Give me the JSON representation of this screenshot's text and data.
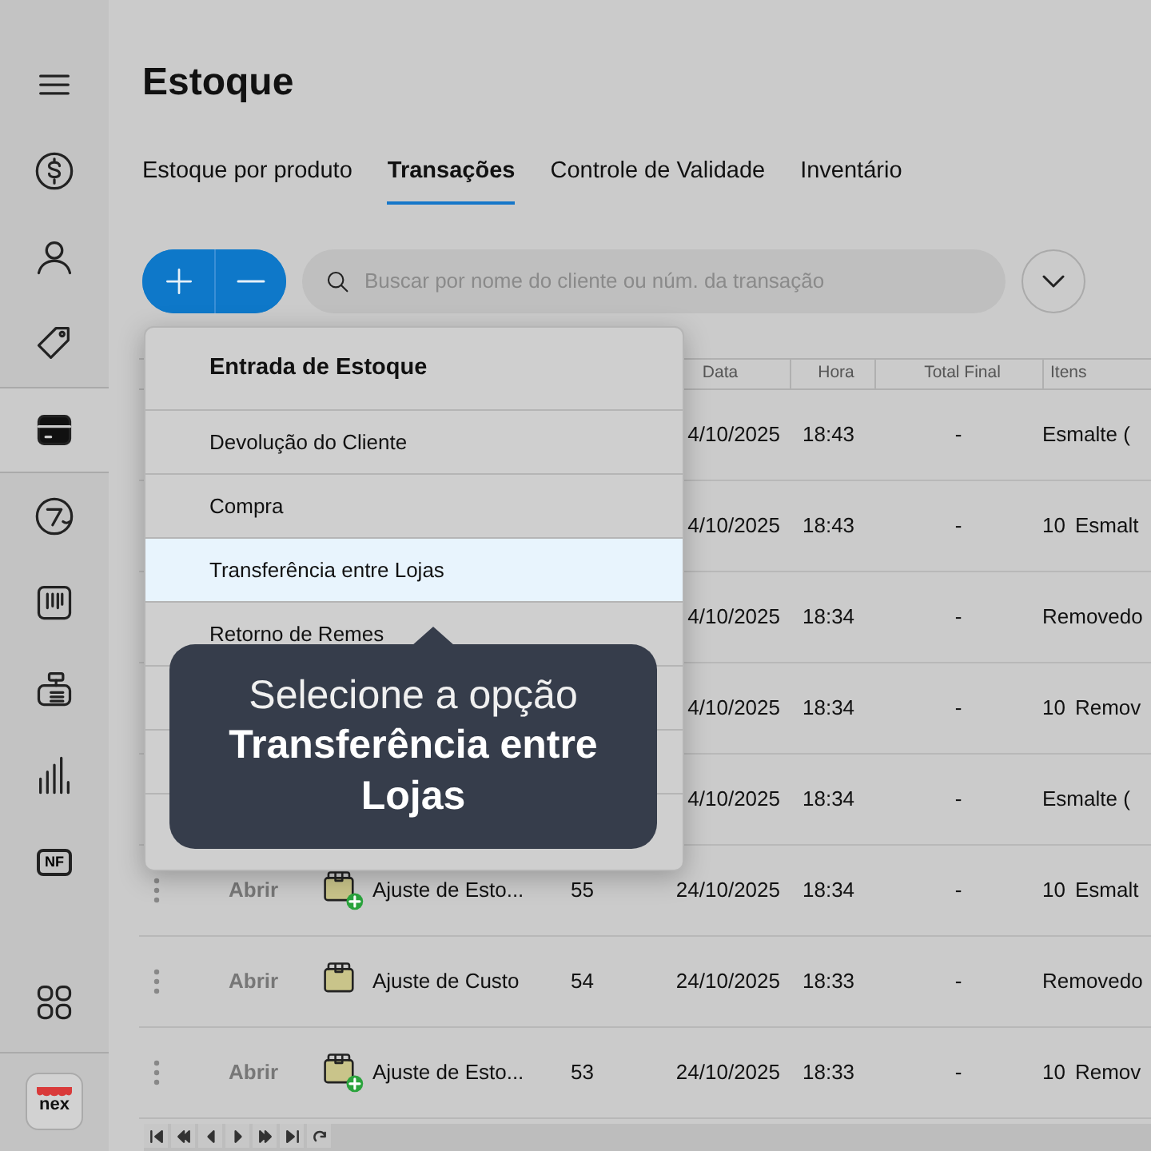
{
  "sidebar": {
    "menu_button": {
      "kind": "menu"
    },
    "items": [
      {
        "kind": "money",
        "selected": false
      },
      {
        "kind": "user",
        "selected": false
      },
      {
        "kind": "tag",
        "selected": false
      },
      {
        "kind": "box",
        "selected": true
      },
      {
        "kind": "disc",
        "selected": false
      },
      {
        "kind": "barcode",
        "selected": false
      },
      {
        "kind": "register",
        "selected": false
      },
      {
        "kind": "chart",
        "selected": false
      },
      {
        "kind": "invoice",
        "label": "NF",
        "selected": false
      }
    ],
    "apps_button": {
      "kind": "apps"
    },
    "logo": {
      "label": "nex"
    }
  },
  "page_title": "Estoque",
  "tabs": [
    {
      "label": "Estoque por produto",
      "selected": false
    },
    {
      "label": "Transações",
      "selected": true
    },
    {
      "label": "Controle de Validade",
      "selected": false
    },
    {
      "label": "Inventário",
      "selected": false
    }
  ],
  "search": {
    "placeholder": "Buscar por nome do cliente ou núm. da transação"
  },
  "table": {
    "columns": [
      "Data",
      "Hora",
      "Total Final",
      "Itens"
    ],
    "rows": [
      {
        "date": "4/10/2025",
        "time": "18:43",
        "total": "-",
        "item": "Esmalte ("
      },
      {
        "date": "4/10/2025",
        "time": "18:43",
        "total": "-",
        "qty": "10",
        "item": "Esmalt"
      },
      {
        "date": "4/10/2025",
        "time": "18:34",
        "total": "-",
        "item": "Removedo"
      },
      {
        "date": "4/10/2025",
        "time": "18:34",
        "total": "-",
        "qty": "10",
        "item": "Remov"
      },
      {
        "date": "4/10/2025",
        "time": "18:34",
        "total": "-",
        "item": "Esmalte ("
      },
      {
        "action": "Abrir",
        "kind": "stock-entry",
        "name": "Ajuste de Esto...",
        "number": "55",
        "date": "24/10/2025",
        "time": "18:34",
        "total": "-",
        "qty": "10",
        "item": "Esmalt"
      },
      {
        "action": "Abrir",
        "kind": "cost",
        "name": "Ajuste de Custo",
        "number": "54",
        "date": "24/10/2025",
        "time": "18:33",
        "total": "-",
        "item": "Removedo"
      },
      {
        "action": "Abrir",
        "kind": "stock-entry",
        "name": "Ajuste de Esto...",
        "number": "53",
        "date": "24/10/2025",
        "time": "18:33",
        "total": "-",
        "qty": "10",
        "item": "Remov"
      }
    ]
  },
  "pager": [
    {
      "kind": "first"
    },
    {
      "kind": "rewind"
    },
    {
      "kind": "prev"
    },
    {
      "kind": "next"
    },
    {
      "kind": "forward"
    },
    {
      "kind": "last"
    },
    {
      "kind": "refresh"
    }
  ],
  "menu": {
    "title": "Entrada de Estoque",
    "items": [
      {
        "label": "Devolução do Cliente",
        "selected": false
      },
      {
        "label": "Compra",
        "selected": false
      },
      {
        "label": "Transferência entre Lojas",
        "selected": true
      },
      {
        "label": "Retorno de Remes",
        "selected": false
      },
      {
        "selected": false
      },
      {
        "selected": false
      }
    ]
  },
  "tooltip": "Selecione a opção **Transferência entre Lojas**"
}
